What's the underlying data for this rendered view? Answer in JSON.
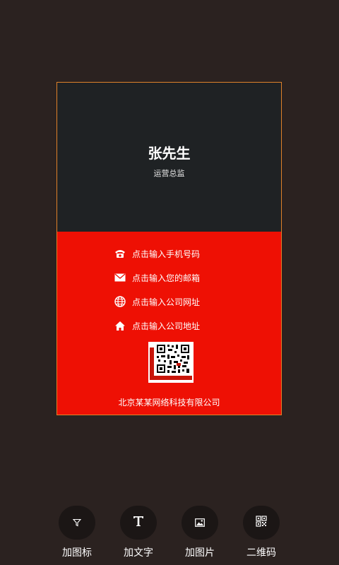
{
  "card": {
    "name": "张先生",
    "title": "运营总监",
    "contacts": [
      {
        "icon": "phone-icon",
        "text": "点击输入手机号码"
      },
      {
        "icon": "mail-icon",
        "text": "点击输入您的邮箱"
      },
      {
        "icon": "globe-icon",
        "text": "点击输入公司网址"
      },
      {
        "icon": "home-icon",
        "text": "点击输入公司地址"
      }
    ],
    "company": "北京某某网络科技有限公司"
  },
  "toolbar": {
    "items": [
      {
        "icon": "funnel-icon",
        "label": "加图标"
      },
      {
        "icon": "text-icon",
        "label": "加文字"
      },
      {
        "icon": "image-icon",
        "label": "加图片"
      },
      {
        "icon": "qr-code-icon",
        "label": "二维码"
      }
    ]
  },
  "colors": {
    "background": "#2b2220",
    "card_top": "#1f2224",
    "card_bottom": "#ee1004",
    "card_border": "#e0822a"
  }
}
